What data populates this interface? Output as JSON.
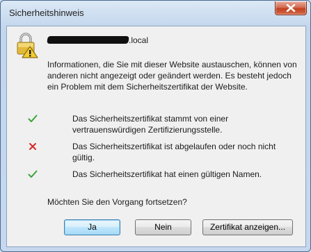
{
  "window": {
    "title": "Sicherheitshinweis"
  },
  "dialog": {
    "host_suffix": ".local",
    "message": "Informationen, die Sie mit dieser Website austauschen, können von anderen nicht angezeigt oder geändert werden. Es besteht jedoch ein Problem mit dem Sicherheitszertifikat der Website.",
    "checks": [
      {
        "status": "ok",
        "icon": "green-checkmark-icon",
        "text": "Das Sicherheitszertifikat stammt von einer vertrauenswürdigen Zertifizierungsstelle."
      },
      {
        "status": "error",
        "icon": "red-x-icon",
        "text": "Das Sicherheitszertifikat ist abgelaufen oder noch nicht gültig."
      },
      {
        "status": "ok",
        "icon": "green-checkmark-icon",
        "text": "Das Sicherheitszertifikat hat einen gültigen Namen."
      }
    ],
    "question": "Möchten Sie den Vorgang fortsetzen?"
  },
  "buttons": {
    "yes": "Ja",
    "no": "Nein",
    "view_certificate": "Zertifikat anzeigen..."
  },
  "colors": {
    "ok": "#3aa33a",
    "error": "#d42a2a",
    "default_button_border": "#3c7fb1"
  }
}
